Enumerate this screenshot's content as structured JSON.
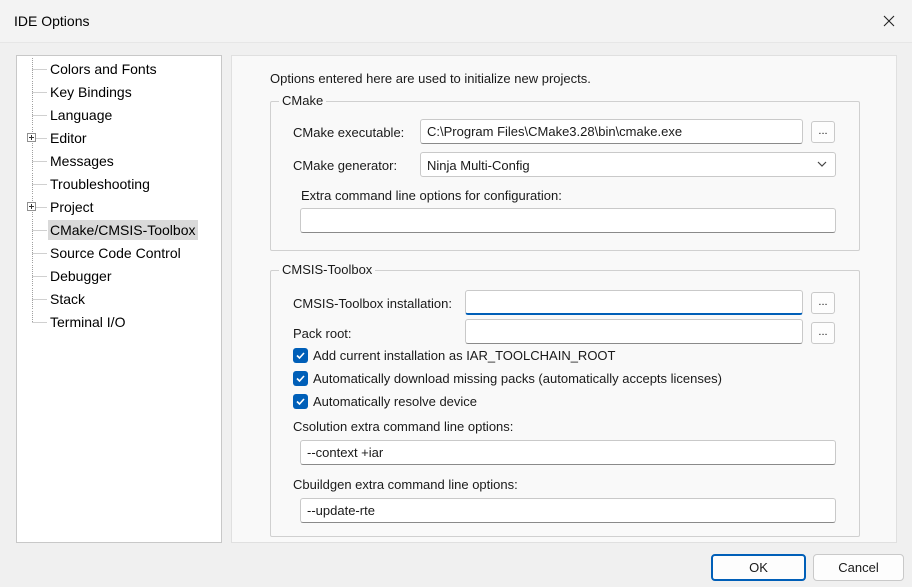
{
  "window": {
    "title": "IDE Options"
  },
  "tree": {
    "items": [
      {
        "label": "Colors and Fonts",
        "expandable": false
      },
      {
        "label": "Key Bindings",
        "expandable": false
      },
      {
        "label": "Language",
        "expandable": false
      },
      {
        "label": "Editor",
        "expandable": true
      },
      {
        "label": "Messages",
        "expandable": false
      },
      {
        "label": "Troubleshooting",
        "expandable": false
      },
      {
        "label": "Project",
        "expandable": true
      },
      {
        "label": "CMake/CMSIS-Toolbox",
        "expandable": false,
        "selected": true
      },
      {
        "label": "Source Code Control",
        "expandable": false
      },
      {
        "label": "Debugger",
        "expandable": false
      },
      {
        "label": "Stack",
        "expandable": false
      },
      {
        "label": "Terminal I/O",
        "expandable": false
      }
    ]
  },
  "intro": "Options entered here are used to initialize new projects.",
  "cmake": {
    "group_title": "CMake",
    "executable_label": "CMake executable:",
    "executable_value": "C:\\Program Files\\CMake3.28\\bin\\cmake.exe",
    "generator_label": "CMake generator:",
    "generator_value": "Ninja Multi-Config",
    "extra_label": "Extra command line options for configuration:",
    "extra_value": ""
  },
  "toolbox": {
    "group_title": "CMSIS-Toolbox",
    "installation_label": "CMSIS-Toolbox installation:",
    "installation_value": "",
    "packroot_label": "Pack root:",
    "packroot_value": "",
    "check1": "Add current installation as IAR_TOOLCHAIN_ROOT",
    "check2": "Automatically download missing packs (automatically accepts licenses)",
    "check3": "Automatically resolve device",
    "csolution_label": "Csolution extra command line options:",
    "csolution_value": "--context +iar",
    "cbuildgen_label": "Cbuildgen extra command line options:",
    "cbuildgen_value": "--update-rte"
  },
  "browse_label": "...",
  "buttons": {
    "ok": "OK",
    "cancel": "Cancel"
  },
  "colors": {
    "accent": "#005fb8",
    "selected_item": "#d9d9d9"
  }
}
